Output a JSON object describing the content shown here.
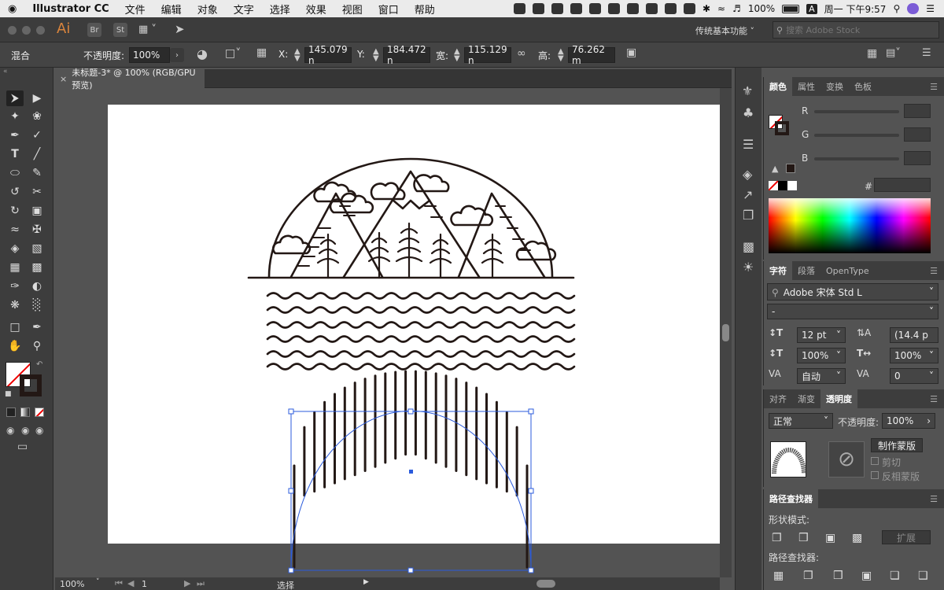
{
  "menubar": {
    "app": "Illustrator CC",
    "items": [
      "文件",
      "编辑",
      "对象",
      "文字",
      "选择",
      "效果",
      "视图",
      "窗口",
      "帮助"
    ],
    "battery": "100%",
    "clock": "周一 下午9:57",
    "input_badge": "A"
  },
  "appbar": {
    "logo": "Ai",
    "br": "Br",
    "st": "St",
    "workspace": "传统基本功能",
    "stock_placeholder": "搜索 Adobe Stock"
  },
  "control": {
    "blend": "混合",
    "opacity_label": "不透明度:",
    "opacity": "100%",
    "x_label": "X:",
    "x": "145.079 n",
    "y_label": "Y:",
    "y": "184.472 n",
    "w_label": "宽:",
    "w": "115.129 n",
    "h_label": "高:",
    "h": "76.262 m"
  },
  "document": {
    "tab_title": "未标题-3* @ 100% (RGB/GPU 预览)",
    "zoom": "100%",
    "page": "1",
    "status": "选择"
  },
  "color_panel": {
    "tabs": [
      "颜色",
      "属性",
      "变换",
      "色板"
    ],
    "r": "R",
    "g": "G",
    "b": "B",
    "hash": "#"
  },
  "char_panel": {
    "tabs": [
      "字符",
      "段落",
      "OpenType"
    ],
    "font": "Adobe 宋体 Std L",
    "style": "-",
    "size": "12 pt",
    "leading": "(14.4 p",
    "vscale": "100%",
    "hscale": "100%",
    "tracking": "自动",
    "kerning": "0"
  },
  "transparency_panel": {
    "tabs": [
      "对齐",
      "渐变",
      "透明度"
    ],
    "mode": "正常",
    "opacity_label": "不透明度:",
    "opacity": "100%",
    "make_mask": "制作蒙版",
    "clip": "剪切",
    "invert": "反相蒙版"
  },
  "pathfinder_panel": {
    "title": "路径查找器",
    "shape_modes": "形状模式:",
    "expand": "扩展",
    "pathfinders": "路径查找器:"
  },
  "colors": {
    "accent": "#2b5bdc",
    "stroke": "#231815"
  }
}
